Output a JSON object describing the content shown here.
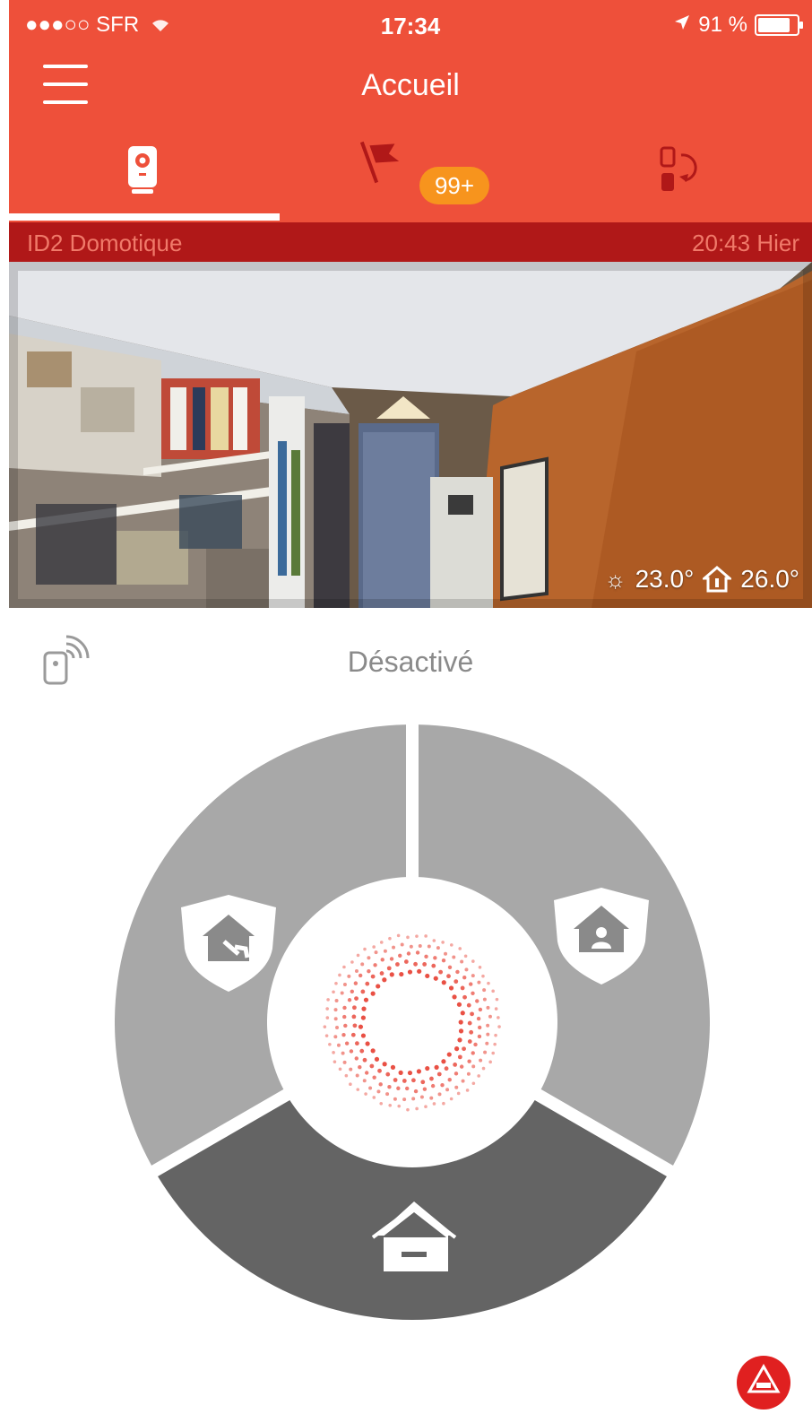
{
  "status_bar": {
    "carrier": "●●●○○ SFR",
    "time": "17:34",
    "battery": "91 %",
    "battery_level": 0.91,
    "wifi_icon": "wifi-icon",
    "location_icon": "location-arrow-icon"
  },
  "nav": {
    "title": "Accueil",
    "menu_icon": "hamburger-menu-icon"
  },
  "tabs": [
    {
      "name": "camera-device",
      "icon": "camera-device-icon",
      "active": true
    },
    {
      "name": "events",
      "icon": "flag-icon",
      "badge": "99+"
    },
    {
      "name": "scenarios",
      "icon": "scenario-swap-icon"
    }
  ],
  "device": {
    "name": "ID2 Domotique",
    "timestamp": "20:43 Hier"
  },
  "camera": {
    "outdoor_temp": "23.0°",
    "indoor_temp": "26.0°"
  },
  "alarm": {
    "status": "Désactivé",
    "modes": [
      {
        "name": "partial",
        "icon": "house-shield-partial-icon"
      },
      {
        "name": "total",
        "icon": "house-shield-person-icon"
      },
      {
        "name": "off",
        "icon": "house-minus-icon",
        "active": true
      }
    ]
  },
  "colors": {
    "primary": "#ee503a",
    "dark_red": "#b01818",
    "badge": "#f7941d",
    "segment_inactive": "#a8a8a8",
    "segment_active": "#646464",
    "dots": "#e8473a"
  },
  "sos_icon": "sos-alert-icon"
}
